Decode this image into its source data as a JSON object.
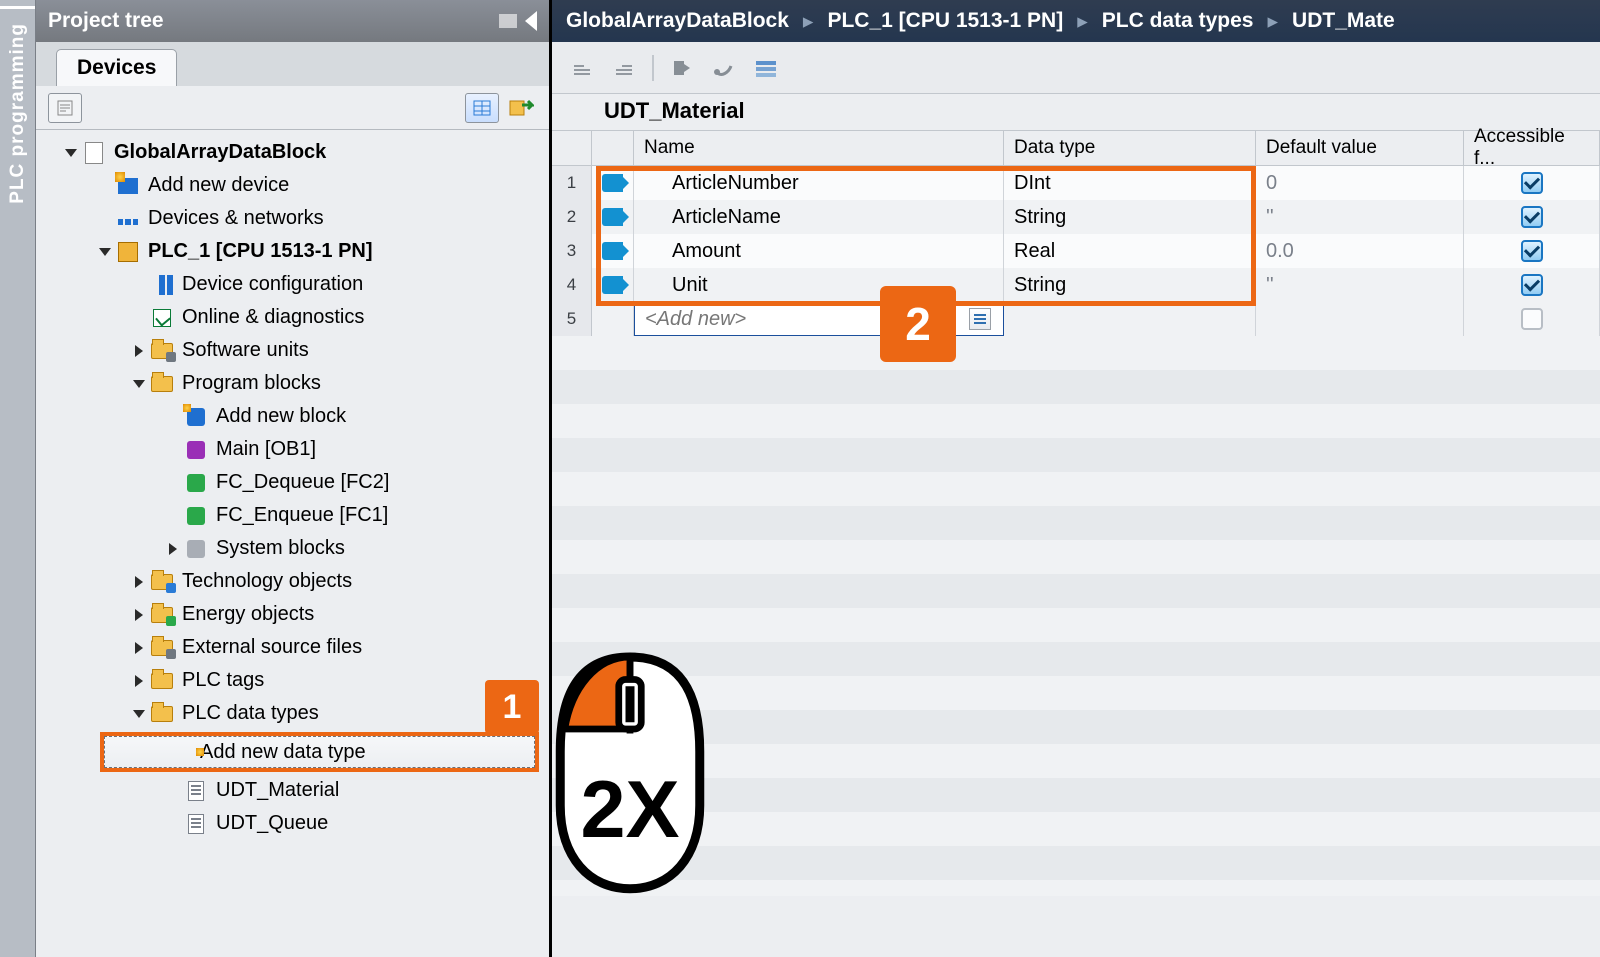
{
  "sidebar_rail": {
    "label": "PLC programming"
  },
  "project_tree": {
    "header": "Project tree",
    "tab": "Devices",
    "nodes": {
      "root": "GlobalArrayDataBlock",
      "add_device": "Add new device",
      "devices_networks": "Devices & networks",
      "plc": "PLC_1 [CPU 1513-1 PN]",
      "device_cfg": "Device configuration",
      "online_diag": "Online & diagnostics",
      "software_units": "Software units",
      "program_blocks": "Program blocks",
      "add_block": "Add new block",
      "main_ob": "Main [OB1]",
      "fc_dequeue": "FC_Dequeue [FC2]",
      "fc_enqueue": "FC_Enqueue [FC1]",
      "system_blocks": "System blocks",
      "tech_objects": "Technology objects",
      "energy_objects": "Energy objects",
      "ext_src": "External source files",
      "plc_tags": "PLC tags",
      "plc_data_types": "PLC data types",
      "add_data_type": "Add new data type",
      "udt_material": "UDT_Material",
      "udt_queue": "UDT_Queue"
    }
  },
  "breadcrumb": {
    "p0": "GlobalArrayDataBlock",
    "p1": "PLC_1 [CPU 1513-1 PN]",
    "p2": "PLC data types",
    "p3": "UDT_Mate"
  },
  "editor": {
    "title": "UDT_Material",
    "columns": {
      "name": "Name",
      "type": "Data type",
      "default": "Default value",
      "accessible": "Accessible f..."
    },
    "rows": [
      {
        "n": "1",
        "name": "ArticleNumber",
        "type": "DInt",
        "def": "0",
        "acc": true
      },
      {
        "n": "2",
        "name": "ArticleName",
        "type": "String",
        "def": "''",
        "acc": true
      },
      {
        "n": "3",
        "name": "Amount",
        "type": "Real",
        "def": "0.0",
        "acc": true
      },
      {
        "n": "4",
        "name": "Unit",
        "type": "String",
        "def": "''",
        "acc": true
      }
    ],
    "add_row_n": "5",
    "add_new": "<Add new>"
  },
  "callouts": {
    "one": "1",
    "two": "2",
    "mouse": "2X"
  }
}
